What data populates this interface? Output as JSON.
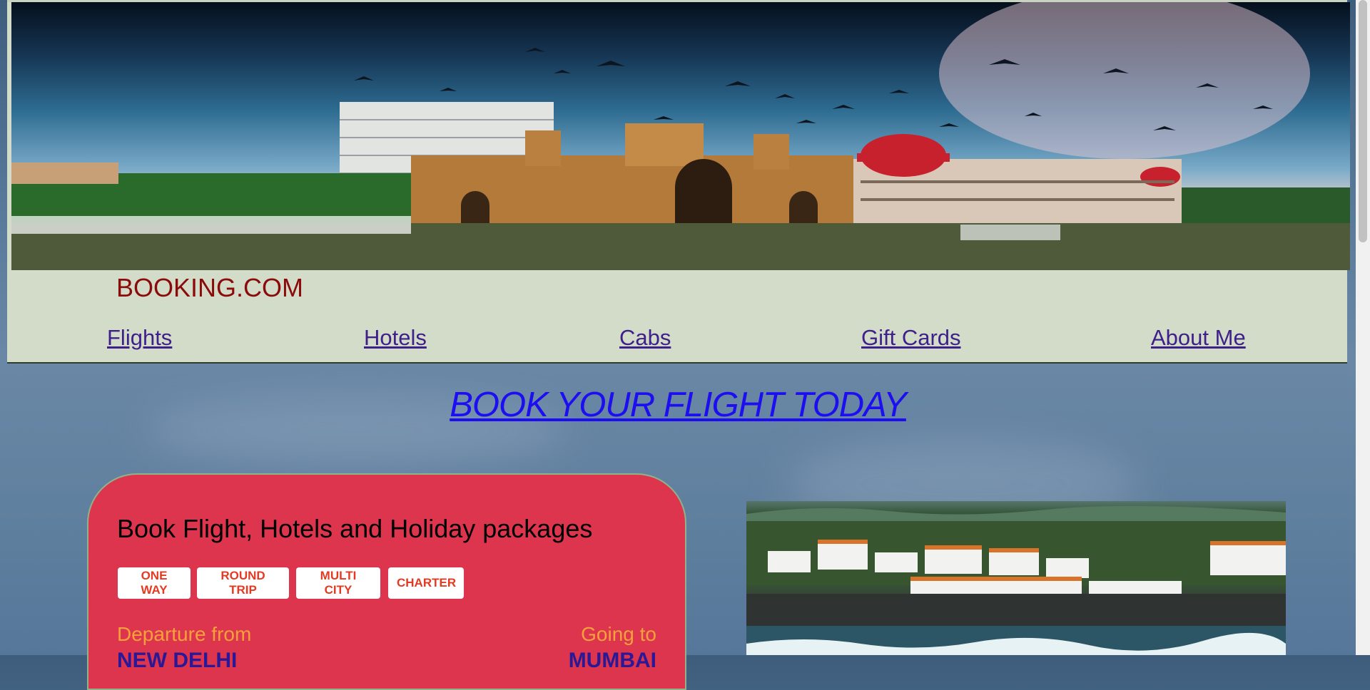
{
  "brand": "BOOKING.COM",
  "nav": [
    "Flights",
    "Hotels",
    "Cabs",
    "Gift Cards",
    "About Me"
  ],
  "headline": "BOOK YOUR FLIGHT TODAY",
  "booking": {
    "title": "Book Flight, Hotels and Holiday packages",
    "trip_types": [
      "ONE WAY",
      "ROUND TRIP",
      "MULTI CITY",
      "CHARTER"
    ],
    "from_label": "Departure from",
    "from_value": "NEW DELHI",
    "to_label": "Going to",
    "to_value": "MUMBAI"
  },
  "icons": {
    "banner": "gateway-of-india-banner-image",
    "photo": "coastal-town-photo"
  }
}
